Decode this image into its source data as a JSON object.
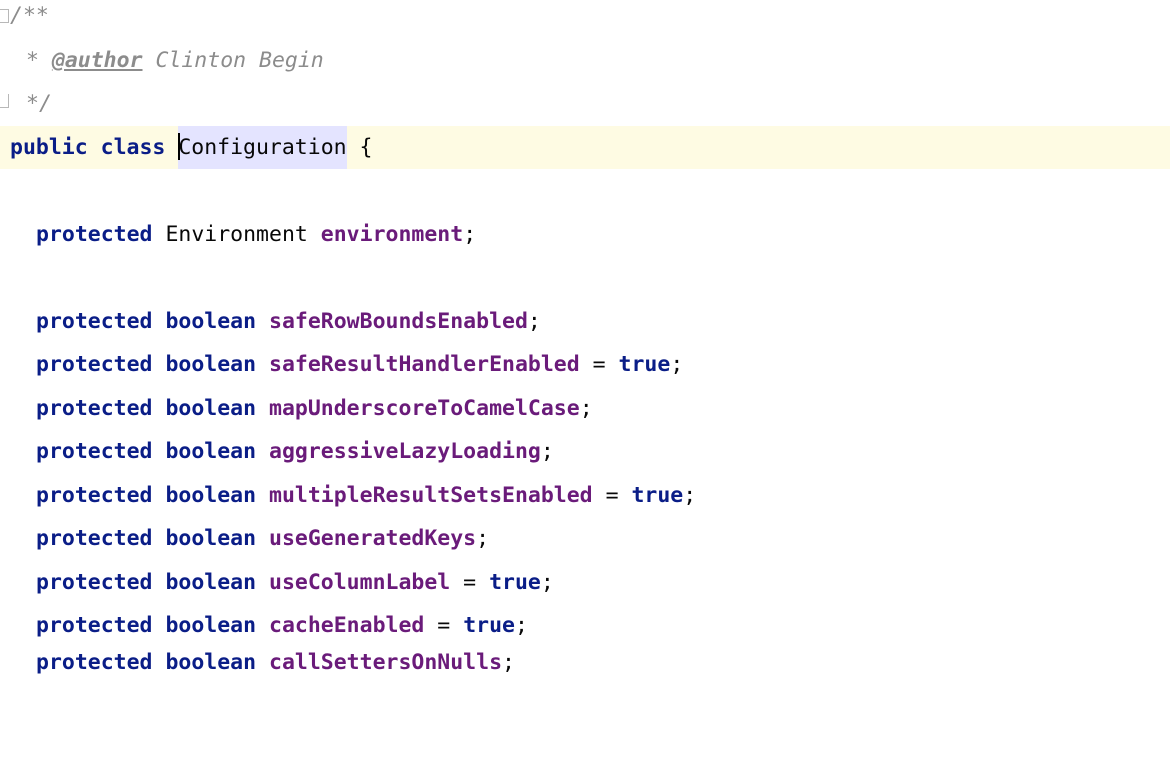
{
  "editor": {
    "doc_comment": {
      "open": "/**",
      "star": "*",
      "author_tag": "@author",
      "author_name": "Clinton Begin",
      "close": "*/"
    },
    "class_decl": {
      "kw_public": "public",
      "kw_class": "class",
      "class_name": "Configuration",
      "brace": "{"
    },
    "env_field": {
      "modifier": "protected",
      "type": "Environment",
      "name": "environment",
      "semicolon": ";"
    },
    "fields": [
      {
        "modifier": "protected",
        "type": "boolean",
        "name": "safeRowBoundsEnabled",
        "assign": "",
        "value": "",
        "end": ";"
      },
      {
        "modifier": "protected",
        "type": "boolean",
        "name": "safeResultHandlerEnabled",
        "assign": " = ",
        "value": "true",
        "end": ";"
      },
      {
        "modifier": "protected",
        "type": "boolean",
        "name": "mapUnderscoreToCamelCase",
        "assign": "",
        "value": "",
        "end": ";"
      },
      {
        "modifier": "protected",
        "type": "boolean",
        "name": "aggressiveLazyLoading",
        "assign": "",
        "value": "",
        "end": ";"
      },
      {
        "modifier": "protected",
        "type": "boolean",
        "name": "multipleResultSetsEnabled",
        "assign": " = ",
        "value": "true",
        "end": ";"
      },
      {
        "modifier": "protected",
        "type": "boolean",
        "name": "useGeneratedKeys",
        "assign": "",
        "value": "",
        "end": ";"
      },
      {
        "modifier": "protected",
        "type": "boolean",
        "name": "useColumnLabel",
        "assign": " = ",
        "value": "true",
        "end": ";"
      },
      {
        "modifier": "protected",
        "type": "boolean",
        "name": "cacheEnabled",
        "assign": " = ",
        "value": "true",
        "end": ";"
      },
      {
        "modifier": "protected",
        "type": "boolean",
        "name": "callSettersOnNulls",
        "assign": "",
        "value": "",
        "end": ";"
      }
    ]
  }
}
